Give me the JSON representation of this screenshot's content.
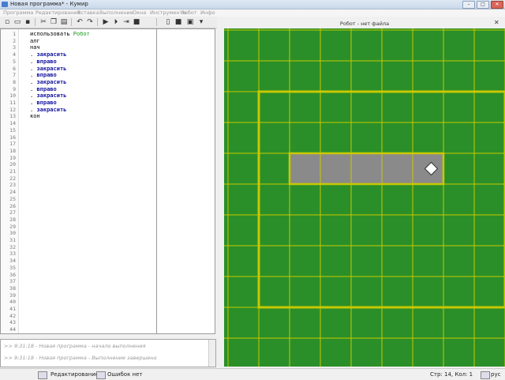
{
  "window": {
    "title": "Новая программа* - Кумир"
  },
  "menu": [
    "Программа",
    "Редактирование",
    "Вставка",
    "Выполнение",
    "Окна",
    "Инструменты",
    "Робот",
    "Инфо"
  ],
  "toolbar": {
    "icons": [
      "new-icon",
      "open-icon",
      "save-icon",
      "cut-icon",
      "copy-icon",
      "paste-icon",
      "undo-icon",
      "redo-icon",
      "run-icon",
      "run-step-icon",
      "step-into-icon",
      "stop-icon",
      "document-icon",
      "black-square-icon",
      "window-icon",
      "dropdown-icon"
    ]
  },
  "editor": {
    "line_count": 44,
    "lines": [
      [
        {
          "t": "использовать ",
          "c": "kw"
        },
        {
          "t": "Робот",
          "c": "robot"
        }
      ],
      [
        {
          "t": "алг",
          "c": "kw"
        }
      ],
      [
        {
          "t": "нач",
          "c": "kw"
        }
      ],
      [
        {
          "t": ". ",
          "c": "kw"
        },
        {
          "t": "закрасить",
          "c": "cmd"
        }
      ],
      [
        {
          "t": ". ",
          "c": "kw"
        },
        {
          "t": "вправо",
          "c": "cmd"
        }
      ],
      [
        {
          "t": ". ",
          "c": "kw"
        },
        {
          "t": "закрасить",
          "c": "cmd"
        }
      ],
      [
        {
          "t": ". ",
          "c": "kw"
        },
        {
          "t": "вправо",
          "c": "cmd"
        }
      ],
      [
        {
          "t": ". ",
          "c": "kw"
        },
        {
          "t": "закрасить",
          "c": "cmd"
        }
      ],
      [
        {
          "t": ". ",
          "c": "kw"
        },
        {
          "t": "вправо",
          "c": "cmd"
        }
      ],
      [
        {
          "t": ". ",
          "c": "kw"
        },
        {
          "t": "закрасить",
          "c": "cmd"
        }
      ],
      [
        {
          "t": ". ",
          "c": "kw"
        },
        {
          "t": "вправо",
          "c": "cmd"
        }
      ],
      [
        {
          "t": ". ",
          "c": "kw"
        },
        {
          "t": "закрасить",
          "c": "cmd"
        }
      ],
      [
        {
          "t": "кон",
          "c": "kw"
        }
      ]
    ]
  },
  "console": {
    "lines": [
      ">> 9:31:18 - Новая программа - начало выполнения",
      ">> 9:31:18 - Новая программа - Выполнение завершено"
    ]
  },
  "statusbar": {
    "mode": "Редактирование",
    "errors": "Ошибок нет",
    "position": "Стр: 14, Кол: 1",
    "lang": "рус"
  },
  "robot_panel": {
    "title": "Робот - нет файла",
    "field": {
      "columns": 8,
      "rows": 7,
      "painted_cells": [
        [
          1,
          2
        ],
        [
          2,
          2
        ],
        [
          3,
          2
        ],
        [
          4,
          2
        ],
        [
          5,
          2
        ]
      ],
      "robot_cell": [
        5,
        2
      ],
      "colors": {
        "background": "#2a8f29",
        "grid": "#c8c800",
        "wall": "#c8c800",
        "painted": "#8a8a8a"
      }
    }
  }
}
